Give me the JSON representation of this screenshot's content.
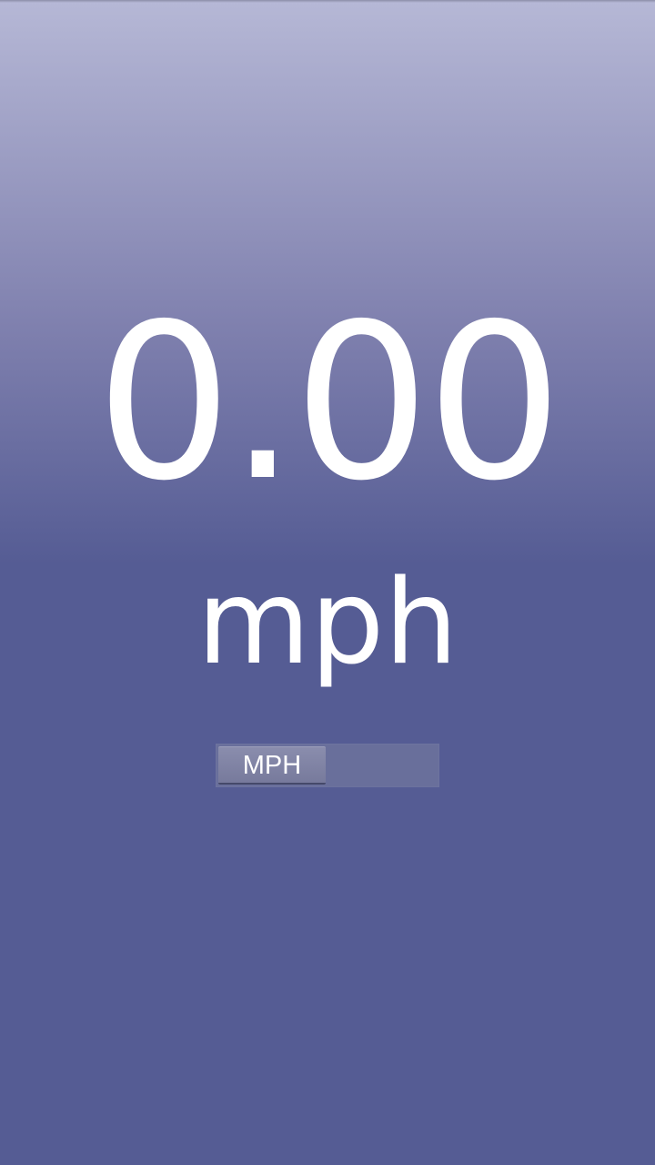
{
  "speedometer": {
    "value": "0.00",
    "unit_label": "mph"
  },
  "unit_toggle": {
    "selected_label": "MPH"
  }
}
